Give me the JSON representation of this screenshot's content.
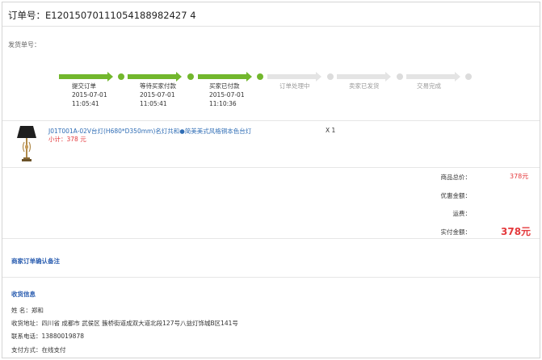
{
  "order": {
    "title": "订单号：E12015070111054188982427 4"
  },
  "shipment": {
    "label": "发货单号："
  },
  "progress": {
    "steps": [
      {
        "label": "提交订单",
        "date": "2015-07-01",
        "time": "11:05:41",
        "status": "done"
      },
      {
        "label": "等待买家付款",
        "date": "2015-07-01",
        "time": "11:05:41",
        "status": "done"
      },
      {
        "label": "买家已付款",
        "date": "2015-07-01",
        "time": "11:10:36",
        "status": "done"
      },
      {
        "label": "订单处理中",
        "date": "",
        "time": "",
        "status": "todo"
      },
      {
        "label": "卖家已发货",
        "date": "",
        "time": "",
        "status": "todo"
      },
      {
        "label": "交易完成",
        "date": "",
        "time": "",
        "status": "todo"
      }
    ]
  },
  "product": {
    "name": "J01T001A-02V台灯(H680*D350mm)名灯共和●简美美式风格铜本色台灯",
    "subtotal": "小计：378 元",
    "quantity": "X 1"
  },
  "summary": {
    "goods_total_label": "商品总价：",
    "goods_total_value": "378元",
    "discount_label": "优惠金额：",
    "discount_value": "",
    "shipping_label": "运费：",
    "shipping_value": "",
    "paid_label": "实付金额：",
    "paid_value": "378元"
  },
  "merchant_note": {
    "title": "商家订单确认备注"
  },
  "receiver": {
    "title": "收货信息",
    "name": "姓      名：郑和",
    "address": "收货地址：四川省 成都市 武侯区 簇桥街道成双大道北段127号八益灯饰城B区141号",
    "phone": "联系电话：13880019878",
    "payment": "支付方式：在线支付"
  },
  "colors": {
    "done": "#72b72d",
    "todo": "#e4e4e4",
    "price": "#e4393c",
    "link": "#2f6db5"
  }
}
